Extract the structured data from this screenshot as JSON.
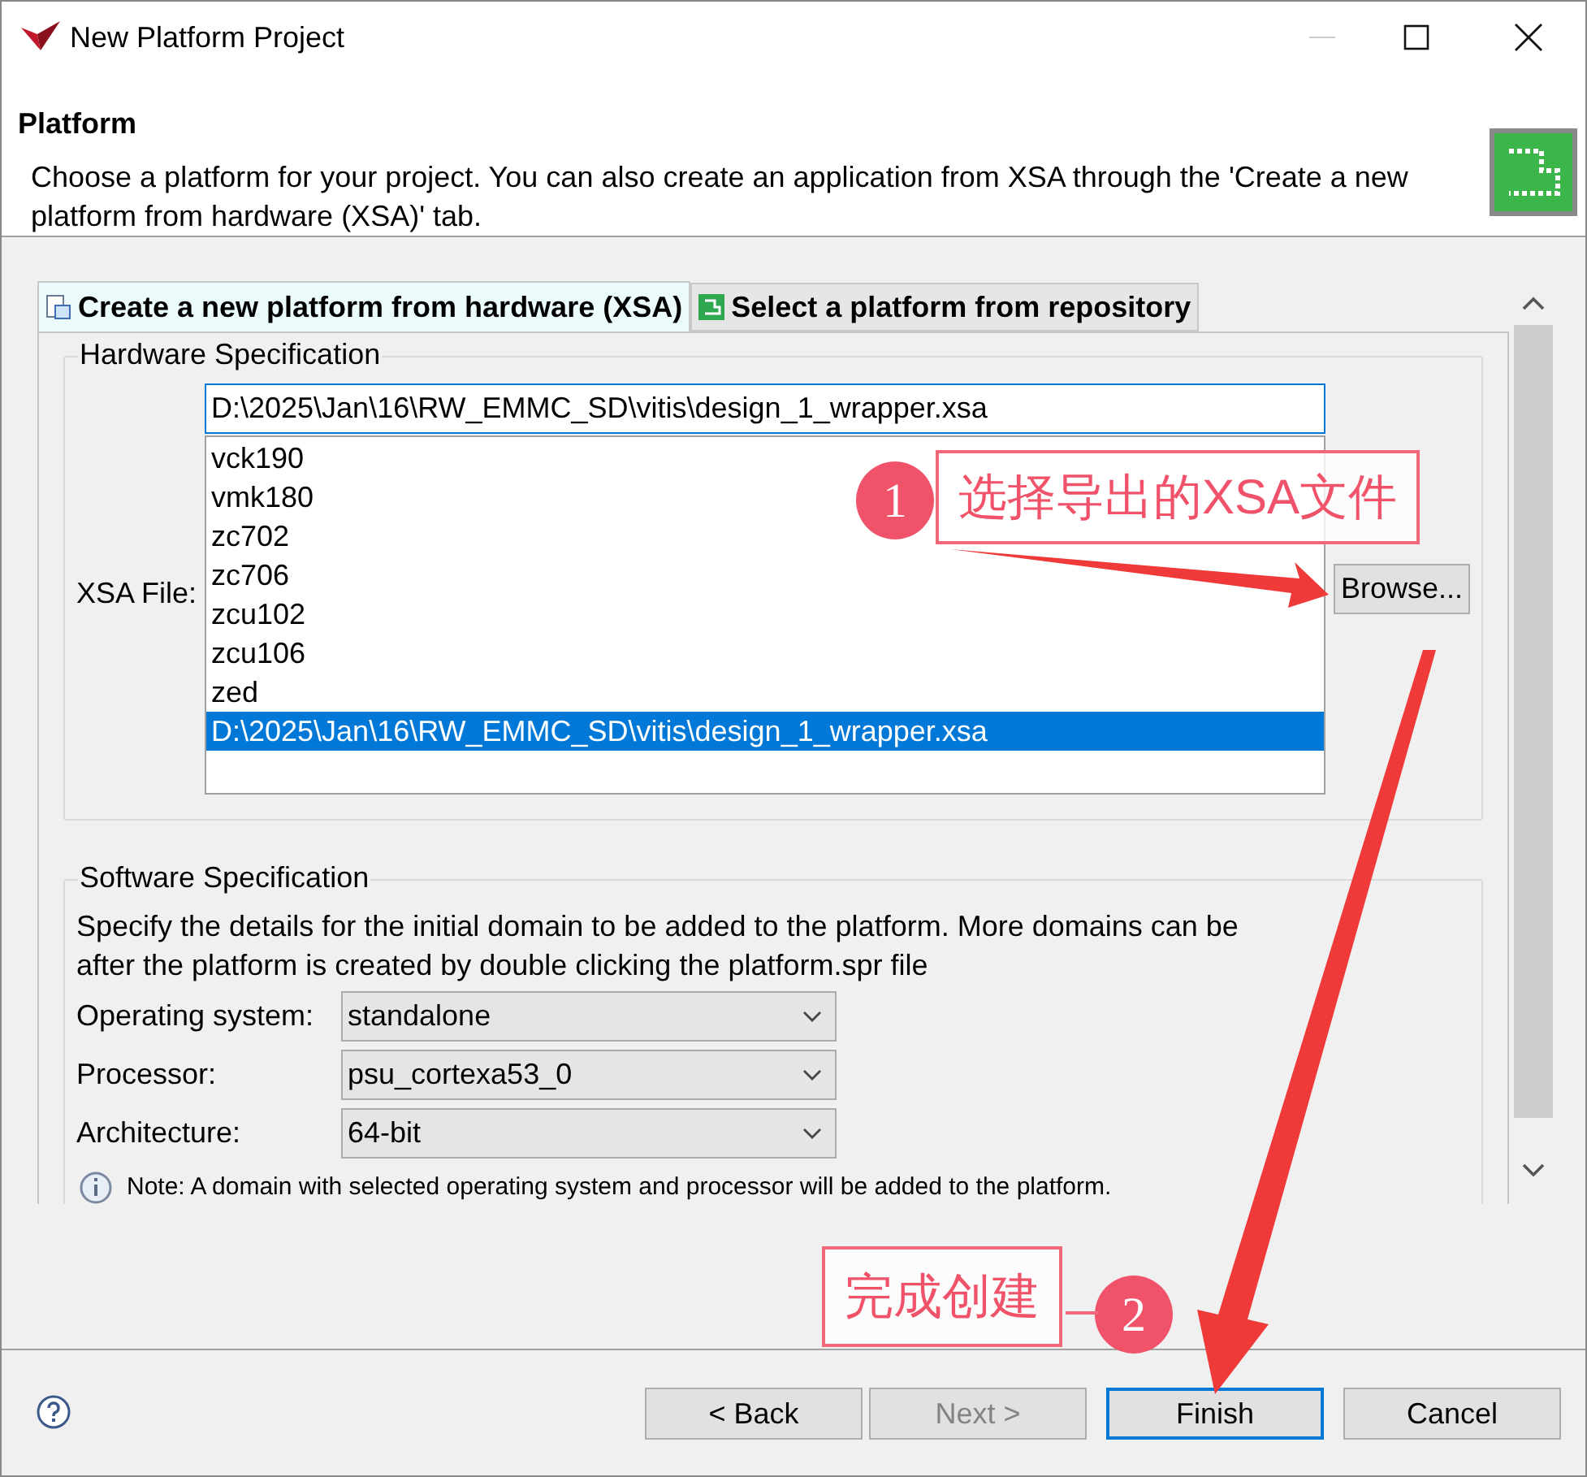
{
  "window": {
    "title": "New Platform Project"
  },
  "header": {
    "title": "Platform",
    "description": "Choose a platform for your project. You can also create an application from XSA through the 'Create a new platform from hardware (XSA)' tab."
  },
  "tabs": [
    {
      "label": "Create a new platform from hardware (XSA)",
      "selected": true
    },
    {
      "label": "Select a platform from repository",
      "selected": false
    }
  ],
  "hardware": {
    "legend": "Hardware Specification",
    "xsa_label": "XSA File:",
    "xsa_value": "D:\\2025\\Jan\\16\\RW_EMMC_SD\\vitis\\design_1_wrapper.xsa",
    "browse": "Browse...",
    "options": [
      {
        "label": "vck190",
        "selected": false
      },
      {
        "label": "vmk180",
        "selected": false
      },
      {
        "label": "zc702",
        "selected": false
      },
      {
        "label": "zc706",
        "selected": false
      },
      {
        "label": "zcu102",
        "selected": false
      },
      {
        "label": "zcu106",
        "selected": false
      },
      {
        "label": "zed",
        "selected": false
      },
      {
        "label": "D:\\2025\\Jan\\16\\RW_EMMC_SD\\vitis\\design_1_wrapper.xsa",
        "selected": true
      }
    ]
  },
  "software": {
    "legend": "Software Specification",
    "description": "Specify the details for the initial domain to be added to the platform. More domains can be after the platform is created by double clicking the platform.spr file",
    "fields": [
      {
        "label": "Operating system:",
        "value": "standalone"
      },
      {
        "label": "Processor:",
        "value": "psu_cortexa53_0"
      },
      {
        "label": "Architecture:",
        "value": "64-bit"
      }
    ],
    "note": "Note: A domain with selected operating system and processor will be added to the platform."
  },
  "buttons": [
    {
      "label": "< Back",
      "disabled": false,
      "default": false
    },
    {
      "label": "Next >",
      "disabled": true,
      "default": false
    },
    {
      "label": "Finish",
      "disabled": false,
      "default": true
    },
    {
      "label": "Cancel",
      "disabled": false,
      "default": false
    }
  ],
  "annotations": [
    {
      "number": "1",
      "text": "选择导出的XSA文件"
    },
    {
      "number": "2",
      "text": "完成创建"
    }
  ]
}
